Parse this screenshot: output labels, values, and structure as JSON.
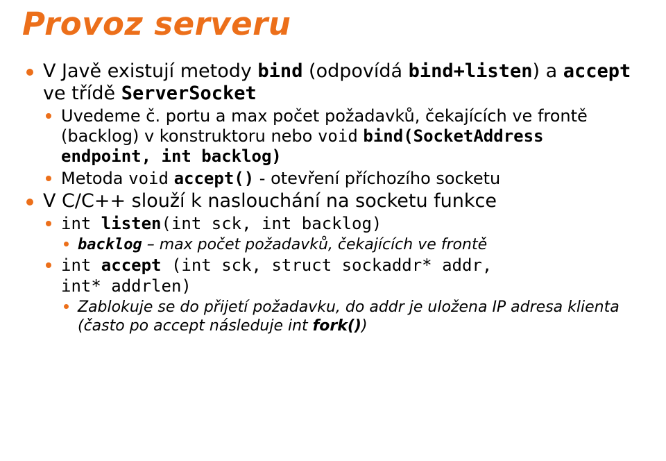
{
  "title": "Provoz serveru",
  "b1": {
    "pre": "V Javě existují metody ",
    "bind": "bind",
    "mid1": " (odpovídá ",
    "bindlisten": "bind+listen",
    "mid2": ") a ",
    "accept": "accept",
    "mid3": " ve třídě ",
    "ss": "ServerSocket"
  },
  "b1s1": {
    "pre": "Uvedeme č. portu a max počet požadavků, čekajících ve frontě (backlog) v konstruktoru nebo ",
    "void": "void",
    "mid1": " ",
    "sig": "bind(SocketAddress endpoint, int backlog)"
  },
  "b1s2": {
    "pre": "Metoda ",
    "void": "void",
    "sp": " ",
    "accept": "accept()",
    "post": " - otevření příchozího socketu"
  },
  "b2": {
    "txt": "V C/C++ slouží k naslouchání na socketu funkce"
  },
  "b2s1": {
    "sig_pre": "int ",
    "listen": "listen",
    "sig_post": "(int sck, int backlog)"
  },
  "b2s1s1": {
    "backlog": "backlog",
    "post": " – max počet požadavků, čekajících ve frontě"
  },
  "b2s2": {
    "line1_pre": "int ",
    "accept": "accept",
    "line1_post": " (int sck, struct sockaddr* addr,",
    "line2": "int* addrlen)"
  },
  "b2s2s1": {
    "pre": "Zablokuje se do přijetí požadavku, do addr je uložena IP adresa klienta (často po accept následuje int ",
    "fork": "fork()",
    "post": ")"
  }
}
